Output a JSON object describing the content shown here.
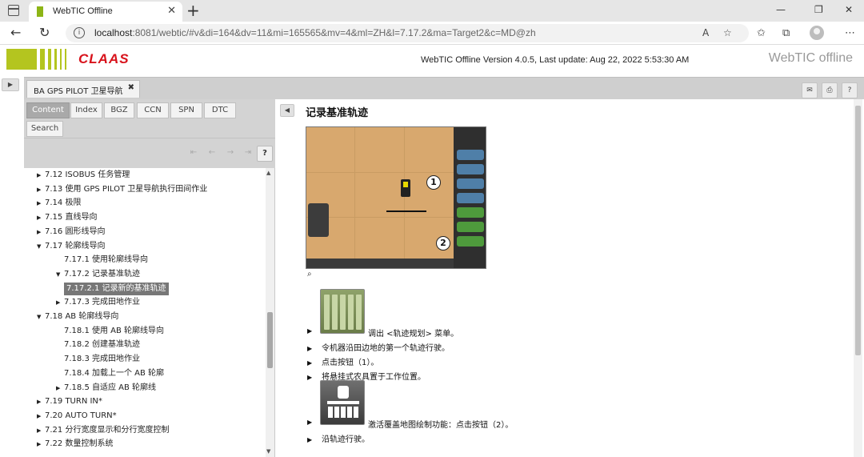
{
  "browser": {
    "tab_title": "WebTIC Offline",
    "tab_close": "✕",
    "new_tab": "+",
    "url_host": "localhost",
    "url_rest": ":8081/webtic/#v&di=164&dv=11&mi=165565&mv=4&ml=ZH&l=7.17.2&ma=Target2&c=MD@zh"
  },
  "header": {
    "brand_logo": "CLAAS",
    "version_text": "WebTIC Offline Version 4.0.5, Last update: Aug 22, 2022 5:53:30 AM",
    "product_name": "WebTIC offline"
  },
  "doc_tab": {
    "label": "BA GPS PILOT 卫星导航",
    "close": "✖"
  },
  "nav_tabs": [
    {
      "label": "Content",
      "active": true
    },
    {
      "label": "Index",
      "active": false
    },
    {
      "label": "BGZ",
      "active": false
    },
    {
      "label": "CCN",
      "active": false
    },
    {
      "label": "SPN",
      "active": false
    },
    {
      "label": "DTC",
      "active": false
    },
    {
      "label": "Search",
      "active": false
    }
  ],
  "nav_toolbar": {
    "help": "?"
  },
  "toc": [
    {
      "label": "7.12 ISOBUS 任务管理",
      "level": 0,
      "arrow": "▶"
    },
    {
      "label": "7.13 使用 GPS PILOT 卫星导航执行田间作业",
      "level": 0,
      "arrow": "▶"
    },
    {
      "label": "7.14 极限",
      "level": 0,
      "arrow": "▶"
    },
    {
      "label": "7.15 直线导向",
      "level": 0,
      "arrow": "▶"
    },
    {
      "label": "7.16 圆形线导向",
      "level": 0,
      "arrow": "▶"
    },
    {
      "label": "7.17 轮廓线导向",
      "level": 0,
      "arrow": "▼"
    },
    {
      "label": "7.17.1 使用轮廓线导向",
      "level": 1,
      "arrow": ""
    },
    {
      "label": "7.17.2 记录基准轨迹",
      "level": 1,
      "arrow": "▼"
    },
    {
      "label": "7.17.2.1 记录新的基准轨迹",
      "level": 2,
      "arrow": "",
      "selected": true
    },
    {
      "label": "7.17.3 完成田地作业",
      "level": 1,
      "arrow": "▶"
    },
    {
      "label": "7.18 AB 轮廓线导向",
      "level": 0,
      "arrow": "▼"
    },
    {
      "label": "7.18.1 使用 AB 轮廓线导向",
      "level": 1,
      "arrow": ""
    },
    {
      "label": "7.18.2 创建基准轨迹",
      "level": 1,
      "arrow": ""
    },
    {
      "label": "7.18.3 完成田地作业",
      "level": 1,
      "arrow": ""
    },
    {
      "label": "7.18.4 加载上一个 AB 轮廓",
      "level": 1,
      "arrow": ""
    },
    {
      "label": "7.18.5 自适应 AB 轮廓线",
      "level": 1,
      "arrow": "▶"
    },
    {
      "label": "7.19 TURN IN*",
      "level": 0,
      "arrow": "▶"
    },
    {
      "label": "7.20 AUTO TURN*",
      "level": 0,
      "arrow": "▶"
    },
    {
      "label": "7.21 分行宽度显示和分行宽度控制",
      "level": 0,
      "arrow": "▶"
    },
    {
      "label": "7.22 数量控制系统",
      "level": 0,
      "arrow": "▶"
    }
  ],
  "content": {
    "title": "记录基准轨迹",
    "callout_1": "1",
    "callout_2": "2",
    "steps": [
      {
        "text": "调出 <轨迹规划> 菜单。",
        "icon": "field-rows-icon"
      },
      {
        "text": "令机器沿田边地的第一个轨迹行驶。"
      },
      {
        "text": "点击按钮（1）。"
      },
      {
        "text": "将悬挂式农具置于工作位置。"
      },
      {
        "text": "激活覆盖地图绘制功能：点击按钮（2）。",
        "icon": "implement-coverage-icon"
      },
      {
        "text": "沿轨迹行驶。"
      }
    ]
  },
  "colors": {
    "claas_green": "#b4c51f",
    "claas_red": "#d8121b",
    "field_brown": "#d8a86e",
    "selected_toc": "#777777"
  }
}
